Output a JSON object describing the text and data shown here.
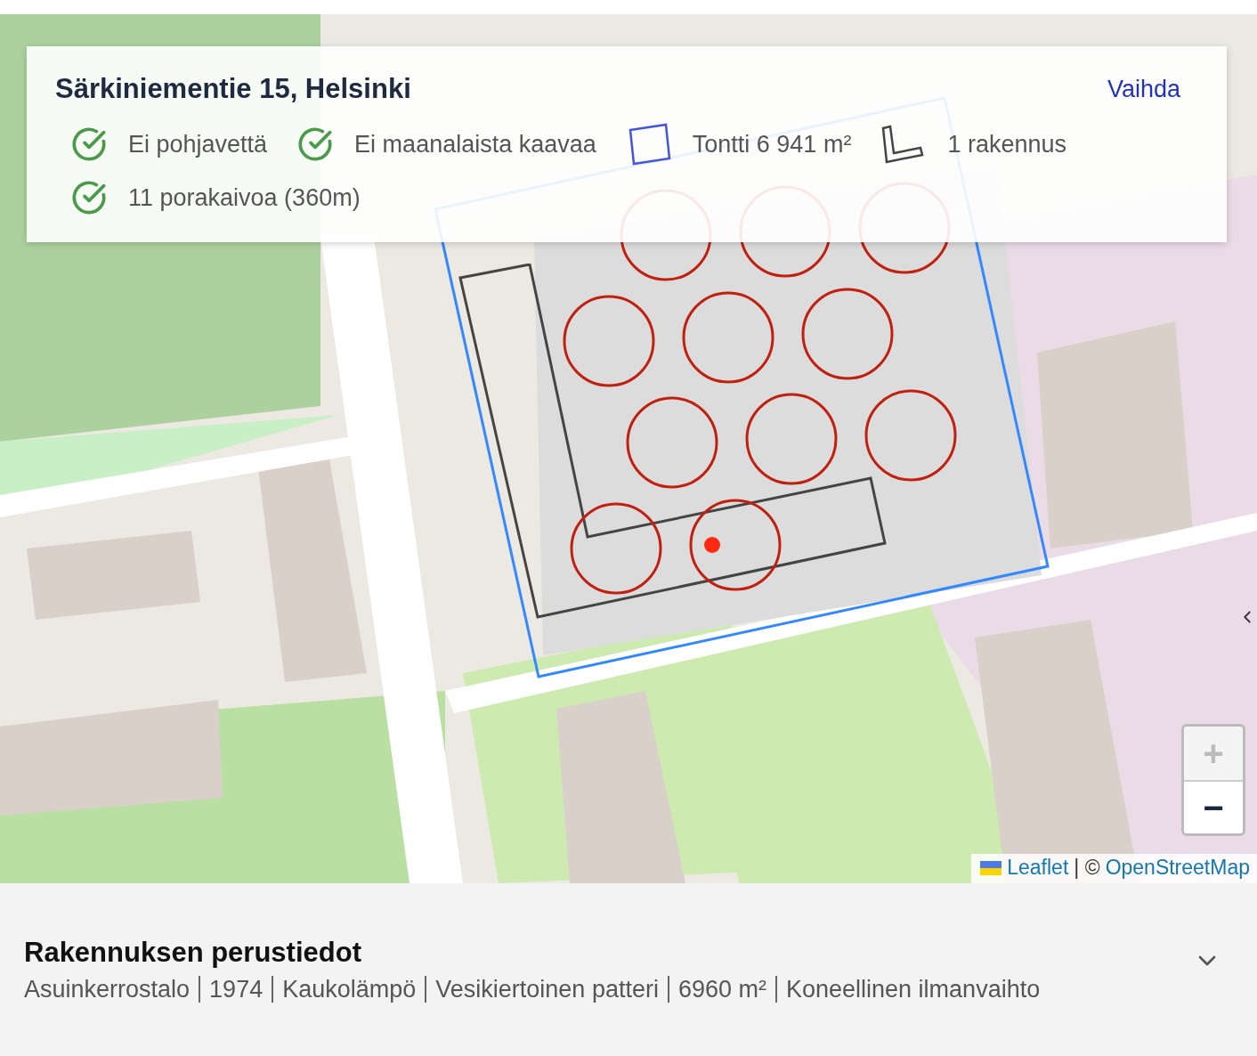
{
  "address": {
    "title": "Särkiniementie 15, Helsinki",
    "action": "Vaihda"
  },
  "facts": [
    {
      "kind": "check",
      "label": "Ei pohjavettä"
    },
    {
      "kind": "check",
      "label": "Ei maanalaista kaavaa"
    },
    {
      "kind": "plot",
      "label": "Tontti 6 941 m²"
    },
    {
      "kind": "building",
      "label": "1 rakennus"
    },
    {
      "kind": "check",
      "label": "11 porakaivoa (360m)"
    }
  ],
  "zoom": [
    {
      "label": "+",
      "disabled": true
    },
    {
      "label": "−",
      "disabled": false
    }
  ],
  "attribution": [
    {
      "kind": "link",
      "text": "Leaflet"
    },
    {
      "kind": "text",
      "text": "| ©"
    },
    {
      "kind": "link",
      "text": "OpenStreetMap"
    }
  ],
  "building": {
    "title": "Rakennuksen perustiedot",
    "expanded": false,
    "details": [
      "Asuinkerrostalo",
      "1974",
      "Kaukolämpö",
      "Vesikiertoinen patteri",
      "6960 m²",
      "Koneellinen ilmanvaihto"
    ]
  }
}
